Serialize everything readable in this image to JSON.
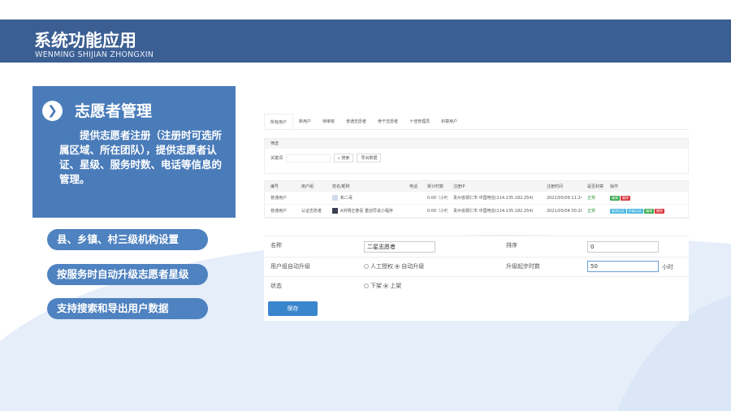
{
  "header": {
    "title": "系统功能应用",
    "subtitle": "WENMING SHIJIAN ZHONGXIN"
  },
  "feature": {
    "icon": "chevron-right-icon",
    "title": "志愿者管理",
    "description": "提供志愿者注册（注册时可选所属区域、所在团队），提供志愿者认证、星级、服务时数、电话等信息的管理。"
  },
  "highlights": [
    "县、乡镇、村三级机构设置",
    "按服务时自动升级志愿者星级",
    "支持搜索和导出用户数据"
  ],
  "screenshot": {
    "tabs": [
      "所有用户",
      "新用户",
      "待审核",
      "普通志愿者",
      "骨干志愿者",
      "十佳管理员",
      "封禁用户"
    ],
    "filter": {
      "title": "筛选",
      "keyword_label": "关键词",
      "search": "搜索",
      "export": "导出数据"
    },
    "columns": [
      "编号",
      "用户组",
      "姓名/昵称",
      "电话",
      "累计时数",
      "注册IP",
      "注册时间",
      "是否封禁",
      "操作"
    ],
    "rows": [
      {
        "id": "普通用户",
        "group": "",
        "name": "和二哥",
        "phone": "",
        "hours": "0.00（小时）",
        "ip": "贵州省铜仁市 中国电信(114.135.182.254)",
        "time": "2021/05/09 11:24",
        "status": "正常",
        "actions": [
          "编辑",
          "删除"
        ]
      },
      {
        "id": "普通用户",
        "group": "认证志愿者",
        "name": "A刘明正春喜 重创早说小程序",
        "phone": "",
        "hours": "0.00（小时）",
        "ip": "贵州省铜仁市 中国电信(114.135.182.254)",
        "time": "2021/05/04 00:26",
        "status": "正常",
        "actions": [
          "取消认证",
          "升级认证",
          "编辑",
          "删除"
        ]
      }
    ]
  },
  "form": {
    "name_label": "名称",
    "name_value": "二星志愿者",
    "order_label": "排序",
    "order_value": "0",
    "upgrade_label": "用户组自动升级",
    "upgrade_options": [
      "人工授权",
      "自动升级"
    ],
    "upgrade_selected": "自动升级",
    "hours_label": "升级起步时数",
    "hours_value": "50",
    "hours_unit": "小时",
    "status_label": "状态",
    "status_options": [
      "下架",
      "上架"
    ],
    "status_selected": "上架",
    "save": "保存"
  },
  "colors": {
    "header": "#3c5f93",
    "panel": "#4a7cba",
    "pill": "#4f82c0",
    "save": "#3a86cc"
  }
}
